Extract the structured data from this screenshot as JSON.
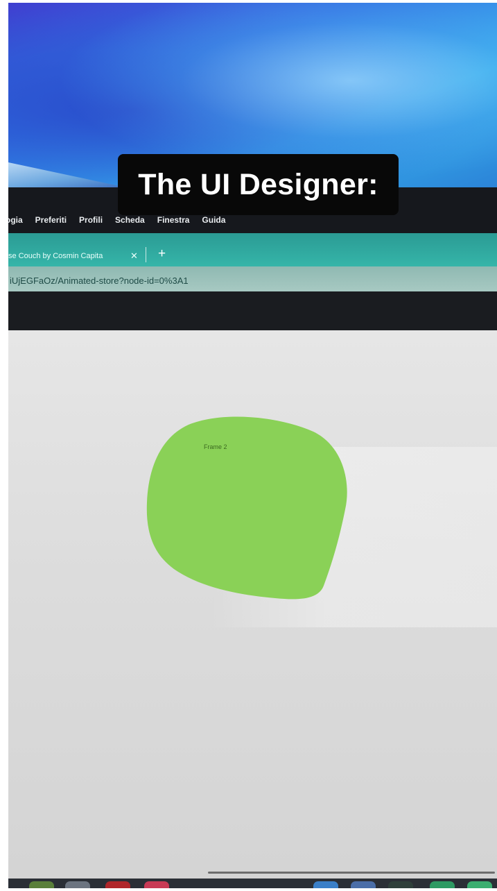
{
  "caption": {
    "text": "The UI Designer:"
  },
  "menubar": {
    "items": [
      "ogia",
      "Preferiti",
      "Profili",
      "Scheda",
      "Finestra",
      "Guida"
    ]
  },
  "tabbar": {
    "tab_title": "se Couch by Cosmin Capita",
    "close_glyph": "✕",
    "new_tab_glyph": "+"
  },
  "urlbar": {
    "url": "iUjEGFaOz/Animated-store?node-id=0%3A1"
  },
  "canvas": {
    "frame_label": "Frame 2",
    "blob_color": "#8ad157"
  },
  "dock": {
    "icons": [
      "app-icon",
      "app-icon",
      "app-icon",
      "app-icon",
      "app-icon",
      "app-icon",
      "app-icon",
      "app-icon"
    ]
  }
}
